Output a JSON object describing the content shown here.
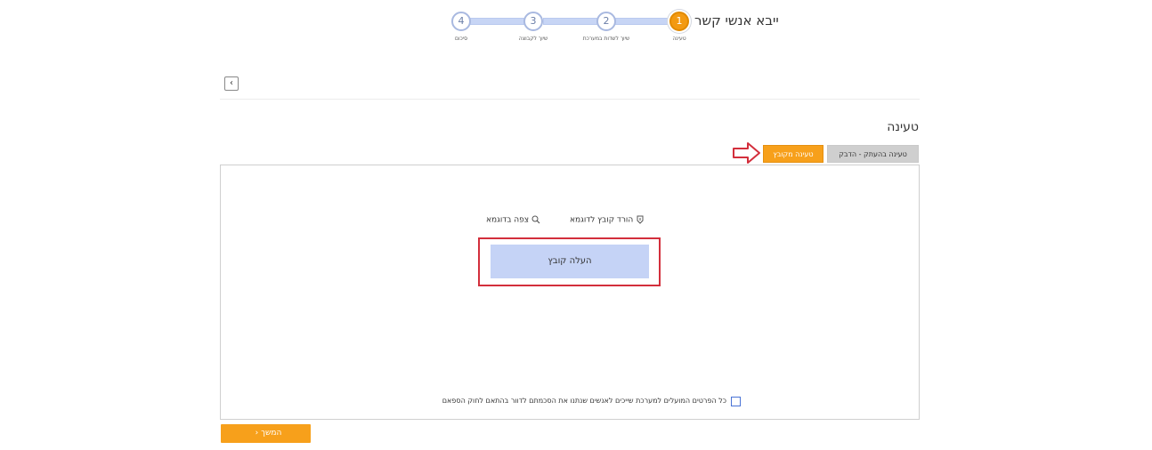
{
  "wizard": {
    "title": "ייבא אנשי קשר",
    "steps": [
      {
        "number": "1",
        "label": "טעינה",
        "active": true
      },
      {
        "number": "2",
        "label": "שיוך לשדות במערכת",
        "active": false
      },
      {
        "number": "3",
        "label": "שיוך לקבוצה",
        "active": false
      },
      {
        "number": "4",
        "label": "סיכום",
        "active": false
      }
    ]
  },
  "nav": {
    "back_icon": "‹"
  },
  "section": {
    "title": "טעינה"
  },
  "tabs": {
    "paste_label": "טעינה בהעתק - הדבק",
    "file_label": "טעינה מקובץ"
  },
  "panel": {
    "download_sample_label": "הורד קובץ לדוגמא",
    "view_sample_label": "צפה בדוגמא",
    "upload_label": "העלה קובץ",
    "consent_text": "כל הפרטים המועלים למערכת שייכים לאנשים שנתנו את הסכמתם לדוור בהתאם לחוק הספאם",
    "consent_checked": false
  },
  "footer": {
    "continue_label": "המשך"
  },
  "colors": {
    "accent": "#f7a01b",
    "upload_bg": "#c5d3f6",
    "highlight": "#d32f3c"
  }
}
